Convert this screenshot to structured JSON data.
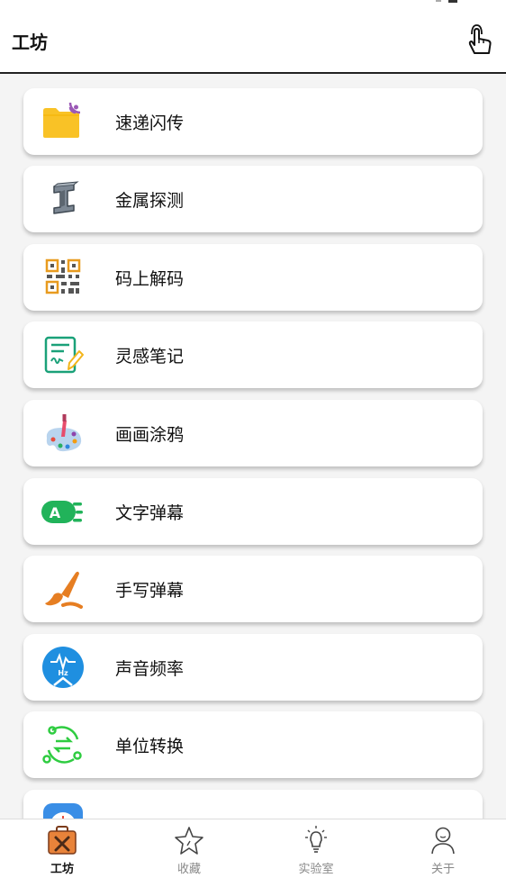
{
  "header": {
    "title": "工坊"
  },
  "items": [
    {
      "label": "速递闪传",
      "icon": "folder-signal-icon"
    },
    {
      "label": "金属探测",
      "icon": "steel-beam-icon"
    },
    {
      "label": "码上解码",
      "icon": "qr-code-icon"
    },
    {
      "label": "灵感笔记",
      "icon": "note-pen-icon"
    },
    {
      "label": "画画涂鸦",
      "icon": "paint-palette-icon"
    },
    {
      "label": "文字弹幕",
      "icon": "text-danmaku-icon"
    },
    {
      "label": "手写弹幕",
      "icon": "brush-stroke-icon"
    },
    {
      "label": "声音频率",
      "icon": "sound-frequency-icon"
    },
    {
      "label": "单位转换",
      "icon": "unit-convert-icon"
    },
    {
      "label": "",
      "icon": "clock-icon"
    }
  ],
  "tabs": [
    {
      "label": "工坊",
      "icon": "toolbox-icon",
      "active": true
    },
    {
      "label": "收藏",
      "icon": "star-icon",
      "active": false
    },
    {
      "label": "实验室",
      "icon": "lightbulb-icon",
      "active": false
    },
    {
      "label": "关于",
      "icon": "person-icon",
      "active": false
    }
  ],
  "colors": {
    "accent_orange": "#f0a020",
    "active_tab": "#111111",
    "inactive_tab": "#888888"
  }
}
